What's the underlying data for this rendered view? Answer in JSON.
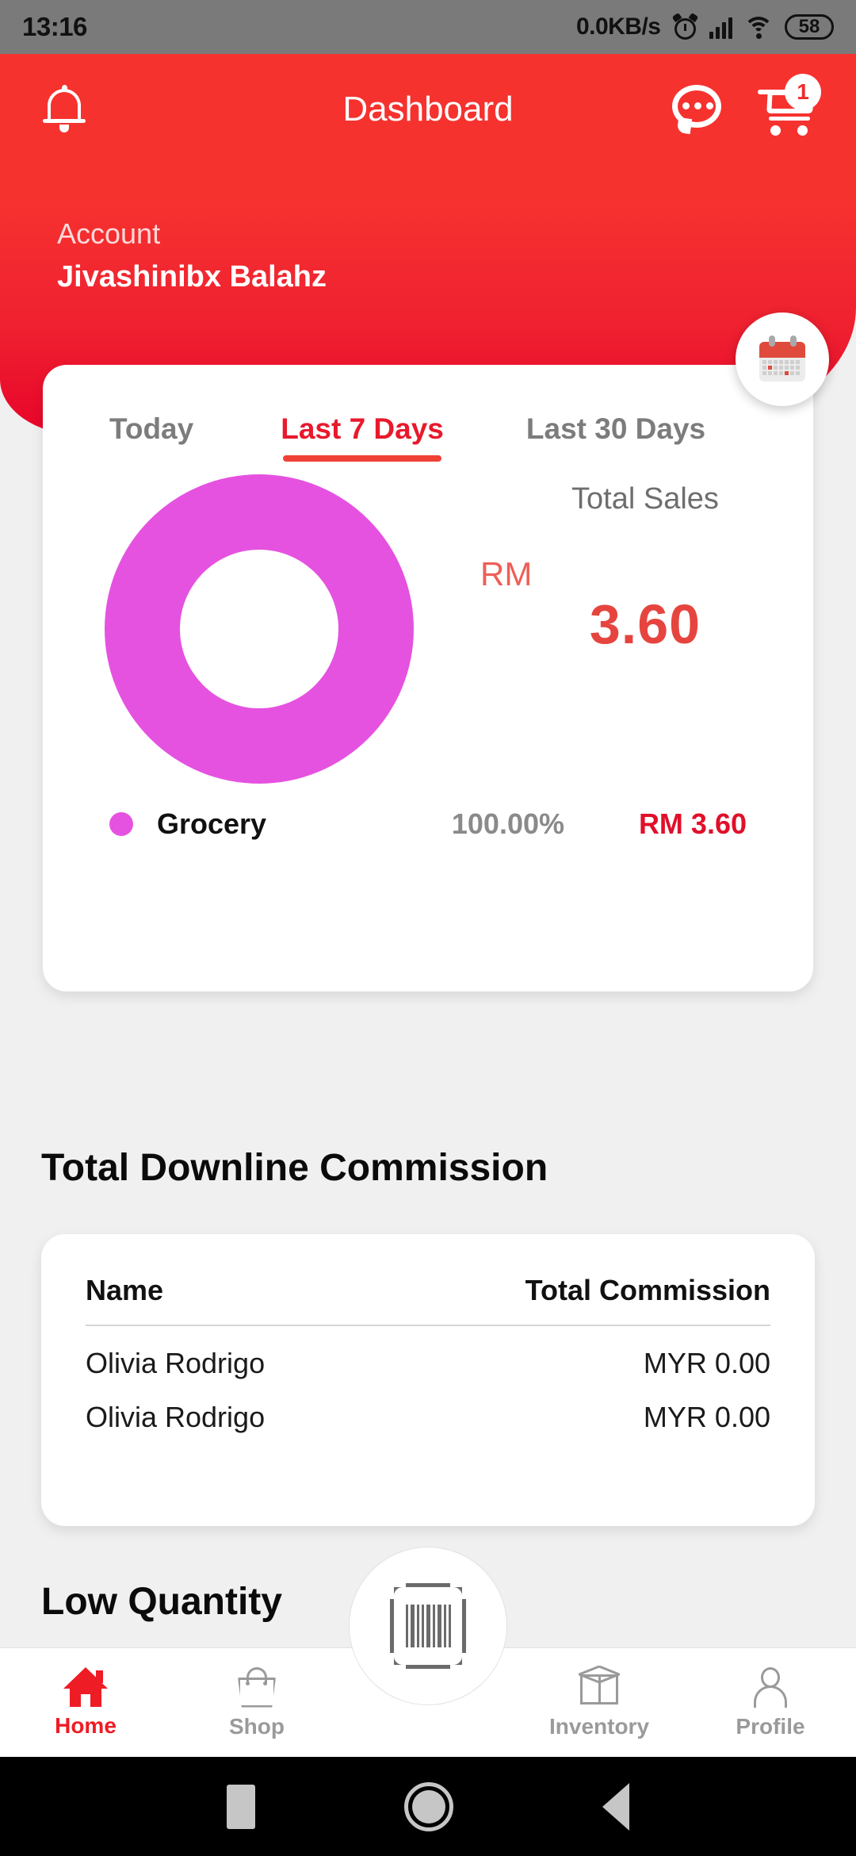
{
  "statusbar": {
    "time": "13:16",
    "network_speed": "0.0KB/s",
    "battery_level": "58",
    "icons": [
      "alarm-icon",
      "signal-icon",
      "wifi-icon",
      "battery-icon"
    ]
  },
  "appbar": {
    "title": "Dashboard",
    "bell_icon": "bell-icon",
    "chat_icon": "chat-icon",
    "cart_icon": "cart-icon",
    "cart_badge": "1"
  },
  "account": {
    "label": "Account",
    "name": "Jivashinibx Balahz"
  },
  "calendar_fab": {
    "icon": "calendar-icon"
  },
  "sales": {
    "tabs": [
      {
        "label": "Today",
        "active": false
      },
      {
        "label": "Last 7 Days",
        "active": true
      },
      {
        "label": "Last 30 Days",
        "active": false
      }
    ],
    "total_sales_label": "Total Sales",
    "currency": "RM",
    "amount": "3.60",
    "legend": {
      "name": "Grocery",
      "percent": "100.00%",
      "amount": "RM 3.60",
      "color": "#E552E0"
    }
  },
  "chart_data": {
    "type": "pie",
    "title": "Total Sales",
    "subtitle": "Last 7 Days",
    "categories": [
      "Grocery"
    ],
    "values": [
      3.6
    ],
    "percentages": [
      100.0
    ],
    "colors": [
      "#E552E0"
    ],
    "currency": "RM",
    "total": 3.6,
    "total_label": "RM 3.60",
    "donut": true,
    "inner_radius_ratio": 0.51,
    "legend_position": "bottom",
    "legend_entries": [
      {
        "label": "Grocery",
        "percent": "100.00%",
        "value": "RM 3.60",
        "color": "#E552E0"
      }
    ]
  },
  "commission": {
    "section_title": "Total Downline Commission",
    "columns": [
      "Name",
      "Total Commission"
    ],
    "rows": [
      {
        "name": "Olivia Rodrigo",
        "amount": "MYR 0.00"
      },
      {
        "name": "Olivia Rodrigo",
        "amount": "MYR 0.00"
      }
    ]
  },
  "low_quantity": {
    "section_title": "Low Quantity"
  },
  "bottomnav": {
    "items": [
      {
        "label": "Home",
        "icon": "home-icon",
        "active": true
      },
      {
        "label": "Shop",
        "icon": "shopping-bag-icon",
        "active": false
      },
      {
        "label": "Inventory",
        "icon": "box-icon",
        "active": false
      },
      {
        "label": "Profile",
        "icon": "person-icon",
        "active": false
      }
    ],
    "scan_icon": "barcode-scan-icon"
  },
  "androidnav": {
    "recents_icon": "square-recents-icon",
    "home_icon": "circle-home-icon",
    "back_icon": "triangle-back-icon"
  },
  "colors": {
    "brand_red": "#EE1C25",
    "header_red": "#F6322F",
    "accent_magenta": "#E552E0",
    "amount_red": "#E6453F",
    "page_bg": "#F0F0F0"
  }
}
